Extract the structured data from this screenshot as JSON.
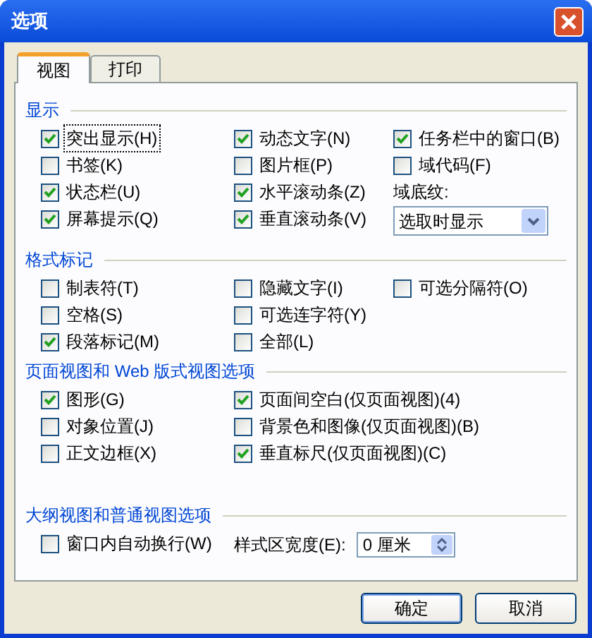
{
  "window": {
    "title": "选项"
  },
  "tabs": [
    {
      "label": "视图",
      "selected": true
    },
    {
      "label": "打印",
      "selected": false
    }
  ],
  "sections": [
    {
      "title": "显示",
      "rows": [
        [
          {
            "kind": "checkbox",
            "label": "突出显示(H)",
            "checked": true,
            "focused": true
          },
          {
            "kind": "checkbox",
            "label": "动态文字(N)",
            "checked": true,
            "focused": false
          },
          {
            "kind": "checkbox",
            "label": "任务栏中的窗口(B)",
            "checked": true,
            "focused": false
          }
        ],
        [
          {
            "kind": "checkbox",
            "label": "书签(K)",
            "checked": false,
            "focused": false
          },
          {
            "kind": "checkbox",
            "label": "图片框(P)",
            "checked": false,
            "focused": false
          },
          {
            "kind": "checkbox",
            "label": "域代码(F)",
            "checked": false,
            "focused": false
          }
        ],
        [
          {
            "kind": "checkbox",
            "label": "状态栏(U)",
            "checked": true,
            "focused": false
          },
          {
            "kind": "checkbox",
            "label": "水平滚动条(Z)",
            "checked": true,
            "focused": false
          },
          {
            "kind": "label",
            "label": "域底纹:"
          }
        ],
        [
          {
            "kind": "checkbox",
            "label": "屏幕提示(Q)",
            "checked": true,
            "focused": false
          },
          {
            "kind": "checkbox",
            "label": "垂直滚动条(V)",
            "checked": true,
            "focused": false
          },
          {
            "kind": "dropdown",
            "value": "选取时显示"
          }
        ]
      ]
    },
    {
      "title": "格式标记",
      "rows": [
        [
          {
            "kind": "checkbox",
            "label": "制表符(T)",
            "checked": false,
            "focused": false
          },
          {
            "kind": "checkbox",
            "label": "隐藏文字(I)",
            "checked": false,
            "focused": false
          },
          {
            "kind": "checkbox",
            "label": "可选分隔符(O)",
            "checked": false,
            "focused": false
          }
        ],
        [
          {
            "kind": "checkbox",
            "label": "空格(S)",
            "checked": false,
            "focused": false
          },
          {
            "kind": "checkbox",
            "label": "可选连字符(Y)",
            "checked": false,
            "focused": false
          }
        ],
        [
          {
            "kind": "checkbox",
            "label": "段落标记(M)",
            "checked": true,
            "focused": false
          },
          {
            "kind": "checkbox",
            "label": "全部(L)",
            "checked": false,
            "focused": false
          }
        ]
      ]
    },
    {
      "title": "页面视图和 Web 版式视图选项",
      "rows": [
        [
          {
            "kind": "checkbox",
            "label": "图形(G)",
            "checked": true,
            "focused": false
          },
          {
            "kind": "checkbox",
            "label": "页面间空白(仅页面视图)(4)",
            "checked": true,
            "focused": false
          }
        ],
        [
          {
            "kind": "checkbox",
            "label": "对象位置(J)",
            "checked": false,
            "focused": false
          },
          {
            "kind": "checkbox",
            "label": "背景色和图像(仅页面视图)(B)",
            "checked": false,
            "focused": false
          }
        ],
        [
          {
            "kind": "checkbox",
            "label": "正文边框(X)",
            "checked": false,
            "focused": false
          },
          {
            "kind": "checkbox",
            "label": "垂直标尺(仅页面视图)(C)",
            "checked": true,
            "focused": false
          }
        ]
      ]
    },
    {
      "title": "大纲视图和普通视图选项",
      "rows": [
        [
          {
            "kind": "checkbox",
            "label": "窗口内自动换行(W)",
            "checked": false,
            "focused": false
          },
          {
            "kind": "spin",
            "label": "样式区宽度(E):",
            "value": "0 厘米"
          }
        ]
      ]
    }
  ],
  "buttons": [
    {
      "label": "确定",
      "default": true
    },
    {
      "label": "取消",
      "default": false
    }
  ]
}
